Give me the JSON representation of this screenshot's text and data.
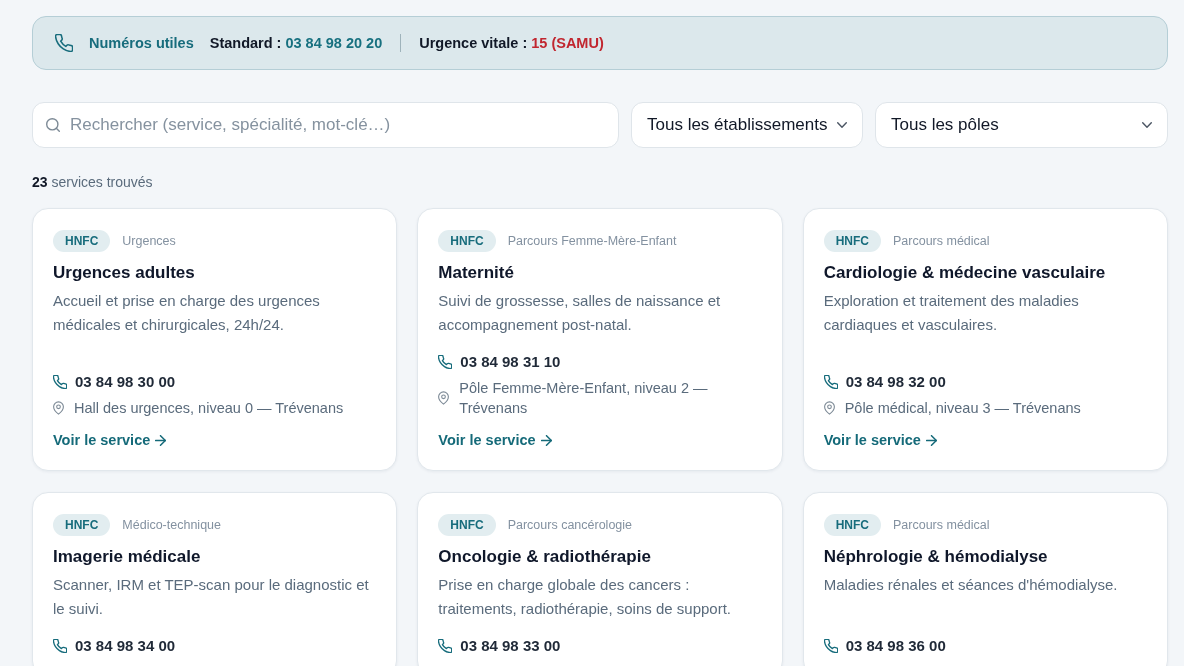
{
  "contact_bar": {
    "title": "Numéros utiles",
    "items": [
      {
        "kind": "standard",
        "label": "Standard :",
        "value": "03 84 98 20 20"
      },
      {
        "kind": "emergency",
        "label": "Urgence vitale :",
        "value": "15 (SAMU)"
      }
    ]
  },
  "filters": {
    "search": {
      "placeholder": "Rechercher (service, spécialité, mot-clé…)"
    },
    "selects": [
      {
        "value": "Tous les établissements"
      },
      {
        "value": "Tous les pôles"
      }
    ]
  },
  "result_count": {
    "count": "23",
    "label": "services trouvés"
  },
  "cards": [
    {
      "badge": "HNFC",
      "category": "Urgences",
      "title": "Urgences adultes",
      "description": "Accueil et prise en charge des urgences médicales et chirurgicales, 24h/24.",
      "phone": "03 84 98 30 00",
      "location": "Hall des urgences, niveau 0 — Trévenans",
      "link": "Voir le service"
    },
    {
      "badge": "HNFC",
      "category": "Parcours Femme-Mère-Enfant",
      "title": "Maternité",
      "description": "Suivi de grossesse, salles de naissance et accompagnement post-natal.",
      "phone": "03 84 98 31 10",
      "location": "Pôle Femme-Mère-Enfant, niveau 2 — Trévenans",
      "link": "Voir le service"
    },
    {
      "badge": "HNFC",
      "category": "Parcours médical",
      "title": "Cardiologie & médecine vasculaire",
      "description": "Exploration et traitement des maladies cardiaques et vasculaires.",
      "phone": "03 84 98 32 00",
      "location": "Pôle médical, niveau 3 — Trévenans",
      "link": "Voir le service"
    },
    {
      "badge": "HNFC",
      "category": "Médico-technique",
      "title": "Imagerie médicale",
      "description": "Scanner, IRM et TEP-scan pour le diagnostic et le suivi.",
      "phone": "03 84 98 34 00"
    },
    {
      "badge": "HNFC",
      "category": "Parcours cancérologie",
      "title": "Oncologie & radiothérapie",
      "description": "Prise en charge globale des cancers : traitements, radiothérapie, soins de support.",
      "phone": "03 84 98 33 00"
    },
    {
      "badge": "HNFC",
      "category": "Parcours médical",
      "title": "Néphrologie & hémodialyse",
      "description": "Maladies rénales et séances d'hémodialyse.",
      "phone": "03 84 98 36 00"
    }
  ]
}
